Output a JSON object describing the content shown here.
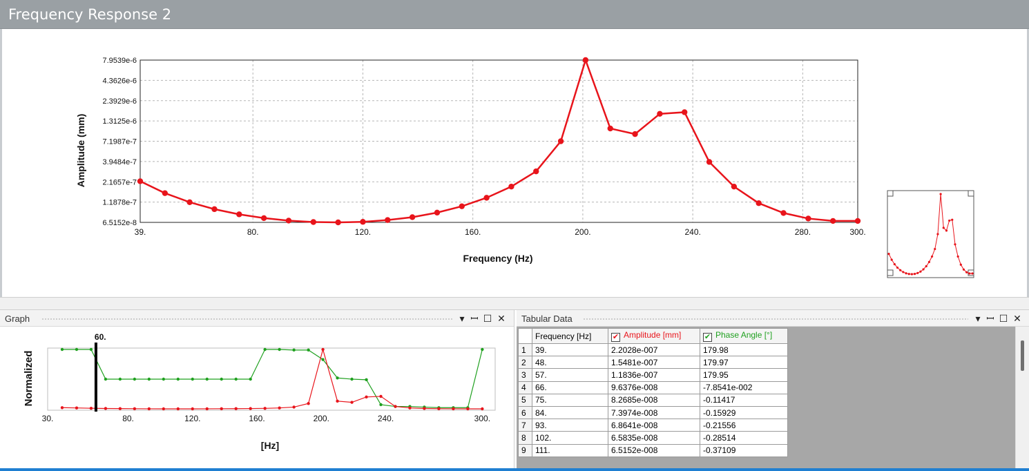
{
  "window": {
    "title": "Frequency Response 2"
  },
  "main_chart": {
    "xlabel": "Frequency (Hz)",
    "ylabel": "Amplitude (mm)",
    "xticks": [
      "39.",
      "80.",
      "120.",
      "160.",
      "200.",
      "240.",
      "280.",
      "300."
    ],
    "yticks": [
      "6.5152e-8",
      "1.1878e-7",
      "2.1657e-7",
      "3.9484e-7",
      "7.1987e-7",
      "1.3125e-6",
      "2.3929e-6",
      "4.3626e-6",
      "7.9539e-6"
    ]
  },
  "graph_panel": {
    "title": "Graph",
    "ylabel": "Normalized",
    "xlabel": "[Hz]",
    "xticks": [
      "30.",
      "80.",
      "120.",
      "160.",
      "200.",
      "240.",
      "300."
    ],
    "cursor_label": "60."
  },
  "table_panel": {
    "title": "Tabular Data",
    "headers": {
      "frequency": "Frequency [Hz]",
      "amplitude": "Amplitude [mm]",
      "phase": "Phase Angle [°]"
    },
    "rows": [
      {
        "n": "1",
        "f": "39.",
        "a": "2.2028e-007",
        "p": "179.98"
      },
      {
        "n": "2",
        "f": "48.",
        "a": "1.5481e-007",
        "p": "179.97"
      },
      {
        "n": "3",
        "f": "57.",
        "a": "1.1836e-007",
        "p": "179.95"
      },
      {
        "n": "4",
        "f": "66.",
        "a": "9.6376e-008",
        "p": "-7.8541e-002"
      },
      {
        "n": "5",
        "f": "75.",
        "a": "8.2685e-008",
        "p": "-0.11417"
      },
      {
        "n": "6",
        "f": "84.",
        "a": "7.3974e-008",
        "p": "-0.15929"
      },
      {
        "n": "7",
        "f": "93.",
        "a": "6.8641e-008",
        "p": "-0.21556"
      },
      {
        "n": "8",
        "f": "102.",
        "a": "6.5835e-008",
        "p": "-0.28514"
      },
      {
        "n": "9",
        "f": "111.",
        "a": "6.5152e-008",
        "p": "-0.37109"
      }
    ]
  },
  "colors": {
    "amplitude": "#e8141b",
    "phase": "#1fa01f",
    "accent": "#1f7fd1"
  },
  "chart_data": [
    {
      "type": "line",
      "xlabel": "Frequency (Hz)",
      "ylabel": "Amplitude (mm)",
      "xlim": [
        39,
        300
      ],
      "ylim": [
        6.5152e-08,
        7.9539e-06
      ],
      "log_y": true,
      "grid": true,
      "series": [
        {
          "x": [
            39,
            48,
            57,
            66,
            75,
            84,
            93,
            102,
            111,
            120,
            129,
            138,
            147,
            156,
            165,
            174,
            183,
            192,
            201,
            210,
            219,
            228,
            237,
            246,
            255,
            264,
            273,
            282,
            291,
            300
          ],
          "values": [
            2.2028e-07,
            1.5481e-07,
            1.1836e-07,
            9.6376e-08,
            8.2685e-08,
            7.3974e-08,
            6.8641e-08,
            6.5835e-08,
            6.5152e-08,
            6.62e-08,
            6.98e-08,
            7.6e-08,
            8.7e-08,
            1.05e-07,
            1.35e-07,
            1.88e-07,
            2.95e-07,
            7.2e-07,
            7.9539e-06,
            1.05e-06,
            8.9e-07,
            1.62e-06,
            1.7e-06,
            3.9e-07,
            1.88e-07,
            1.15e-07,
            8.6e-08,
            7.3e-08,
            6.8e-08,
            6.8e-08
          ]
        }
      ]
    },
    {
      "type": "line",
      "xlabel": "[Hz]",
      "ylabel": "Normalized",
      "xlim": [
        30,
        308
      ],
      "cursor_x": 60,
      "series": [
        {
          "x": [
            39,
            48,
            57,
            66,
            75,
            84,
            93,
            102,
            111,
            120,
            129,
            138,
            147,
            156,
            165,
            174,
            183,
            192,
            201,
            210,
            219,
            228,
            237,
            246,
            255,
            264,
            273,
            282,
            291,
            300
          ],
          "values": [
            0.02,
            0.015,
            0.01,
            0.006,
            0.004,
            0.002,
            0.001,
            0.0,
            0.0,
            0.0,
            0.001,
            0.002,
            0.003,
            0.005,
            0.008,
            0.015,
            0.03,
            0.09,
            1.0,
            0.13,
            0.11,
            0.2,
            0.21,
            0.04,
            0.015,
            0.006,
            0.002,
            0.001,
            0.0,
            0.0
          ]
        },
        {
          "x": [
            39,
            48,
            57,
            66,
            75,
            84,
            93,
            102,
            111,
            120,
            129,
            138,
            147,
            156,
            165,
            174,
            183,
            192,
            201,
            210,
            219,
            228,
            237,
            246,
            255,
            264,
            273,
            282,
            291,
            300
          ],
          "values": [
            1.0,
            1.0,
            1.0,
            0.5,
            0.5,
            0.5,
            0.5,
            0.5,
            0.5,
            0.5,
            0.5,
            0.5,
            0.5,
            0.5,
            1.0,
            1.0,
            0.99,
            0.99,
            0.83,
            0.52,
            0.5,
            0.49,
            0.07,
            0.04,
            0.04,
            0.03,
            0.02,
            0.02,
            0.02,
            1.0
          ]
        }
      ]
    }
  ]
}
